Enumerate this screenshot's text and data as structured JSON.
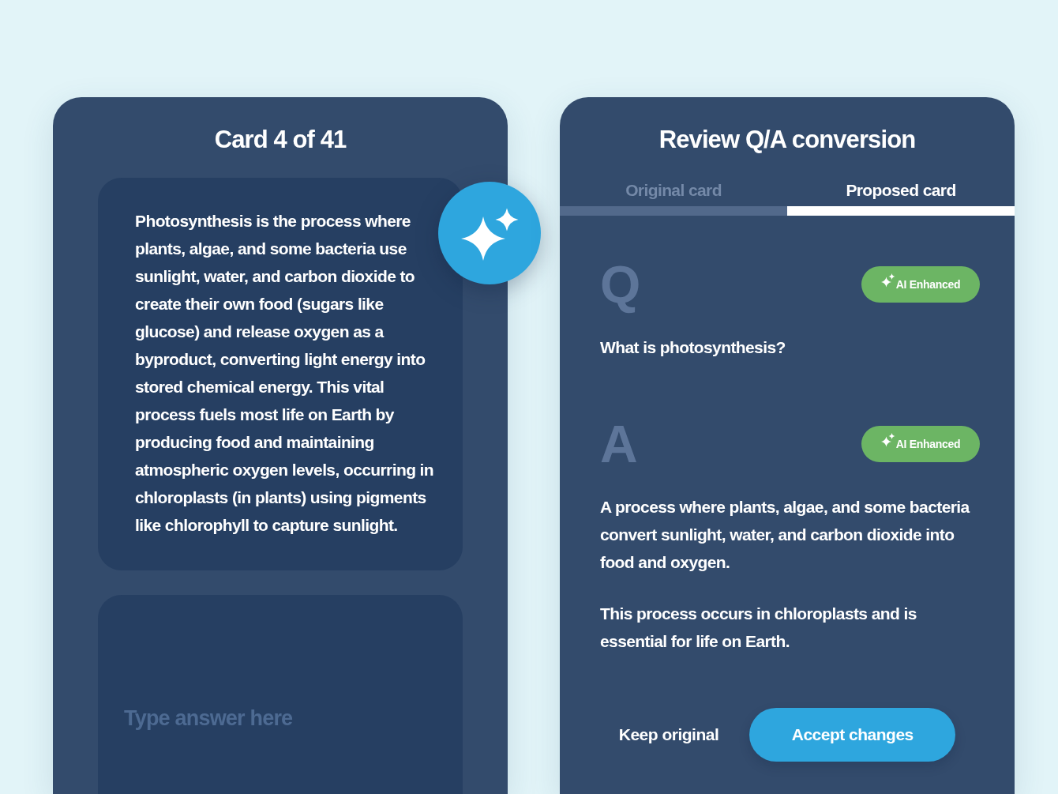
{
  "card_panel": {
    "title": "Card 4 of 41",
    "card_text": "Photosynthesis is the process where plants, algae, and some bacteria use sunlight, water, and carbon dioxide to create their own food (sugars like glucose) and release oxygen as a byproduct, converting light energy into stored chemical energy. This vital process fuels most life on Earth by producing food and maintaining atmospheric oxygen levels, occurring in chloroplasts (in plants) using pigments like chlorophyll to capture sunlight.",
    "answer_field": {
      "placeholder": "Type answer here"
    }
  },
  "review_panel": {
    "title": "Review Q/A conversion",
    "tabs": [
      {
        "label": "Original card",
        "selected": false
      },
      {
        "label": "Proposed card",
        "selected": true
      }
    ],
    "sections": [
      {
        "letter": "Q",
        "badge": "AI Enhanced",
        "paragraphs": [
          "What is photosynthesis?"
        ]
      },
      {
        "letter": "A",
        "badge": "AI Enhanced",
        "paragraphs": [
          "A process where plants, algae, and some bacteria convert sunlight, water, and carbon dioxide into food and oxygen.",
          "This process occurs in chloroplasts and is essential for life on Earth."
        ]
      }
    ],
    "buttons": [
      {
        "label": "Keep original",
        "kind": "text"
      },
      {
        "label": "Accept changes",
        "kind": "primary"
      }
    ]
  }
}
